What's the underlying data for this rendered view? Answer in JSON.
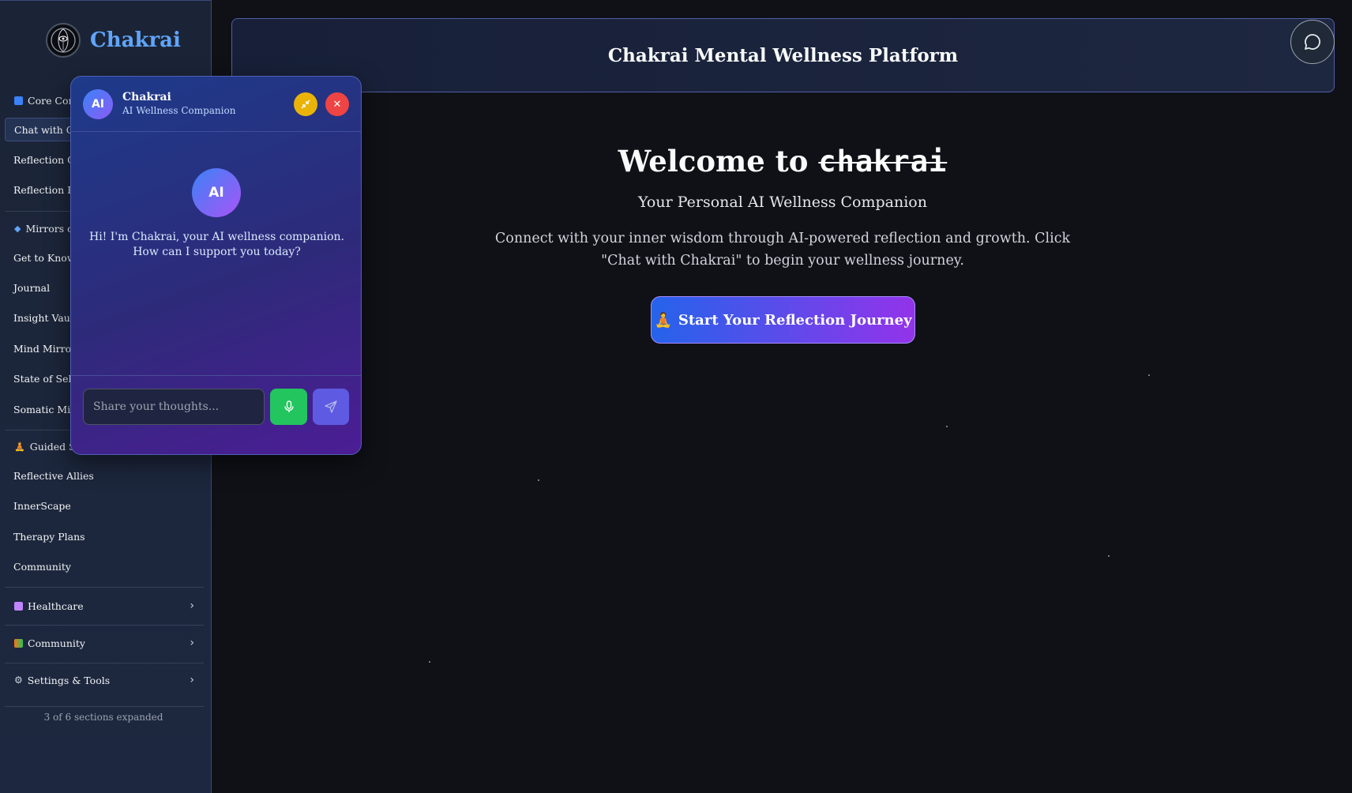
{
  "app": {
    "name": "Chakrai"
  },
  "header": {
    "title": "Chakrai Mental Wellness Platform"
  },
  "sidebar": {
    "sections": [
      {
        "icon": "blue-square-icon",
        "label": "Core Com",
        "items": [
          "Chat with Ch",
          "Reflection Go",
          "Reflection Re"
        ]
      },
      {
        "icon": "blue-diamond-icon",
        "label": "Mirrors o",
        "items": [
          "Get to Know",
          "Journal",
          "Insight Vault",
          "Mind Mirror",
          "State of Self",
          "Somatic Mirr"
        ]
      },
      {
        "icon": "meditation-icon",
        "label": "Guided Su",
        "items": [
          "Reflective Allies",
          "InnerScape",
          "Therapy Plans",
          "Community"
        ]
      }
    ],
    "collapsed": [
      {
        "icon": "hospital-icon",
        "label": "Healthcare"
      },
      {
        "icon": "community-icon",
        "label": "Community"
      },
      {
        "icon": "gear-icon",
        "label": "Settings & Tools"
      }
    ],
    "status": "3 of 6 sections expanded"
  },
  "hero": {
    "welcome": "Welcome to",
    "brand_word": "chakrai",
    "subtitle": "Your Personal AI Wellness Companion",
    "description": "Connect with your inner wisdom through AI-powered reflection and growth. Click \"Chat with Chakrai\" to begin your wellness journey.",
    "cta_icon": "🧘",
    "cta_label": "Start Your Reflection Journey"
  },
  "chat": {
    "avatar_text": "AI",
    "name": "Chakrai",
    "role": "AI Wellness Companion",
    "greeting": "Hi! I'm Chakrai, your AI wellness companion. How can I support you today?",
    "input_placeholder": "Share your thoughts...",
    "input_value": ""
  },
  "colors": {
    "accent": "#60a5fa",
    "cta_start": "#2563eb",
    "cta_end": "#9333ea",
    "mic": "#22c55e",
    "minimize": "#eab308",
    "close": "#ef4444"
  }
}
